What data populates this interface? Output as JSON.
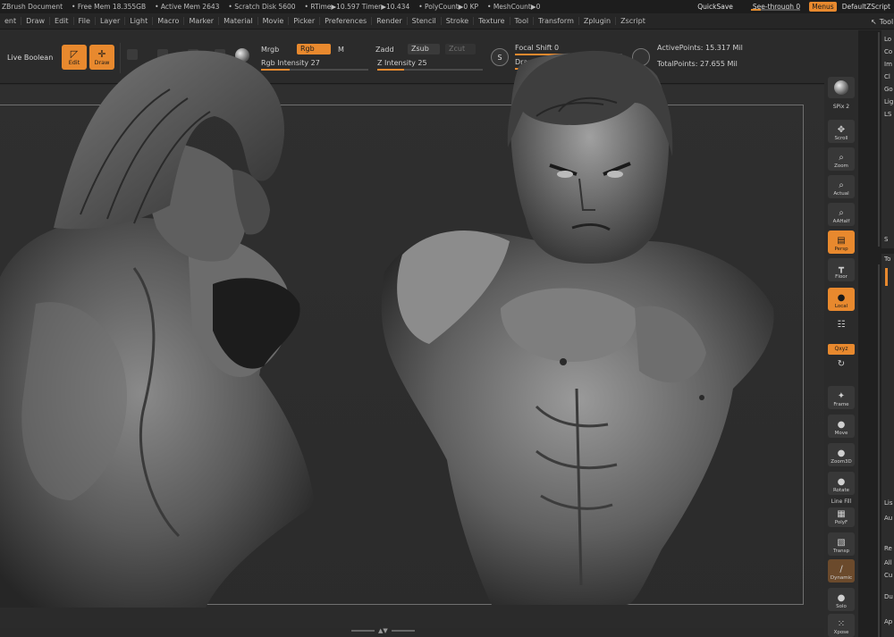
{
  "status_bar": {
    "items": [
      "ZBrush Document",
      "• Free Mem 18.355GB",
      "• Active Mem 2643",
      "• Scratch Disk 5600",
      "• RTime▶10.597 Timer▶10.434",
      "• PolyCount▶0 KP",
      "• MeshCount▶0"
    ],
    "quicksave": "QuickSave",
    "see_through": "See-through  0",
    "see_through_value": 0.2,
    "menus": "Menus",
    "default_script": "DefaultZScript"
  },
  "menu_bar": {
    "items": [
      "ent",
      "Draw",
      "Edit",
      "File",
      "Layer",
      "Light",
      "Macro",
      "Marker",
      "Material",
      "Movie",
      "Picker",
      "Preferences",
      "Render",
      "Stencil",
      "Stroke",
      "Texture",
      "Tool",
      "Transform",
      "Zplugin",
      "Zscript"
    ],
    "right_label": "Tool"
  },
  "shelf": {
    "live_boolean": "Live Boolean",
    "edit": "Edit",
    "draw": "Draw",
    "mrgb": "Mrgb",
    "rgb": "Rgb",
    "m": "M",
    "zadd": "Zadd",
    "zsub": "Zsub",
    "zcut": "Zcut",
    "rgb_intensity": "Rgb Intensity 27",
    "rgb_intensity_value": 27,
    "z_intensity": "Z Intensity 25",
    "z_intensity_value": 25,
    "focal_shift": "Focal Shift 0",
    "draw_size": "Draw Size 1",
    "active_points": "ActivePoints: 15.317 Mil",
    "total_points": "TotalPoints: 27.655 Mil",
    "s_icon_label": "S"
  },
  "right_shelf": {
    "spix": "SPix 2",
    "scroll": "Scroll",
    "zoom": "Zoom",
    "actual": "Actual",
    "aahalf": "AAHalf",
    "persp": "Persp",
    "floor": "Floor",
    "local": "Local",
    "xyz": "Qxyz",
    "frame": "Frame",
    "move": "Move",
    "zoom3d": "Zoom3D",
    "rotate": "Rotate",
    "line_fill": "Line Fill",
    "polyf": "PolyF",
    "transp": "Transp",
    "dynamic": "Dynamic",
    "solo": "Solo",
    "xpose": "Xpose"
  },
  "tray": {
    "lines": [
      "Lo",
      "Co",
      "Im",
      "Cl",
      "Go",
      "Lig",
      "LS"
    ],
    "lower_lines": [
      "S"
    ],
    "bottom_lines": [
      "Lis",
      "Au",
      "Re",
      "All",
      "Cu",
      "Du",
      "Ap"
    ],
    "tool_header": "To"
  },
  "colors": {
    "accent": "#e8892e",
    "background": "#2a2a2a",
    "bar": "#1d1d1d"
  }
}
